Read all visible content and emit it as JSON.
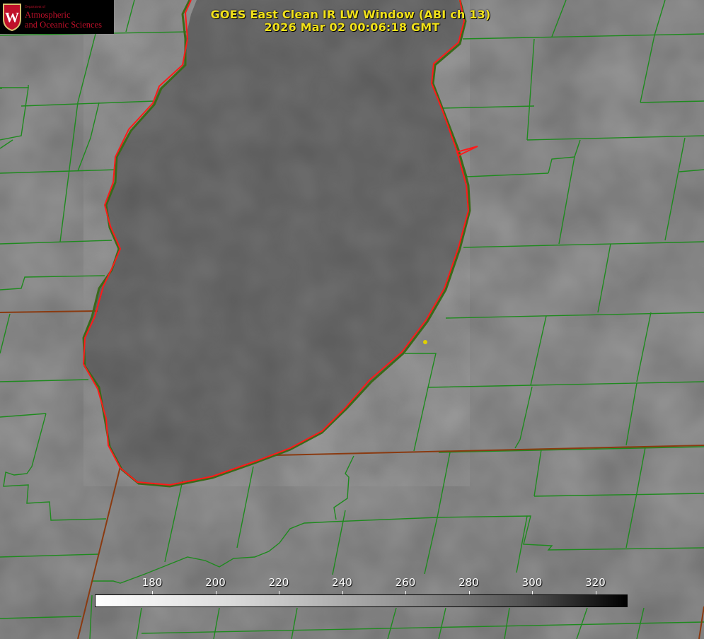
{
  "title": {
    "line1": "GOES East Clean IR LW Window (ABI ch 13)",
    "line2": "2026 Mar 02 00:06:18 GMT"
  },
  "logo": {
    "dept": "Department of",
    "line1": "Atmospheric",
    "line2": "and Oceanic Sciences",
    "shield_letter": "W"
  },
  "colorbar": {
    "ticks": [
      "180",
      "200",
      "220",
      "240",
      "260",
      "280",
      "300",
      "320"
    ],
    "colors": [
      "#ffffff",
      "#000000"
    ]
  },
  "map_colors": {
    "coastline": "#ff1a1a",
    "county_borders": "#1e8a1e",
    "state_borders": "#8a3a10",
    "marker": "#e0d000"
  }
}
